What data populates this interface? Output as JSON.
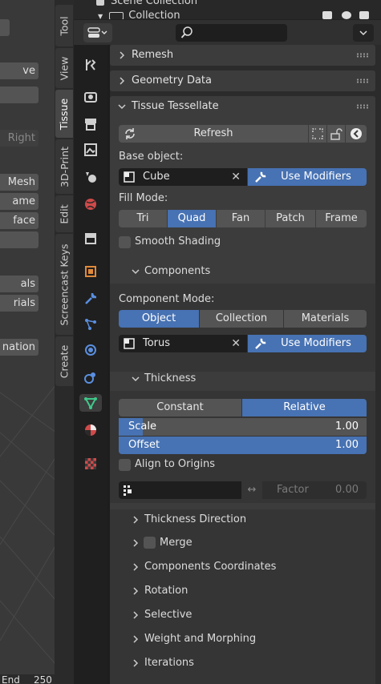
{
  "viewport": {
    "buttons": [
      {
        "label": "ve"
      },
      {
        "label": ""
      },
      {
        "label": "Right"
      },
      {
        "label": "Mesh"
      },
      {
        "label": "ame"
      },
      {
        "label": "face"
      },
      {
        "label": ""
      },
      {
        "label": "als"
      },
      {
        "label": "rials"
      },
      {
        "label": "nation"
      }
    ],
    "end_label": "End",
    "end_value": "250"
  },
  "vertical_tabs": [
    "Tool",
    "View",
    "Tissue",
    "3D-Print",
    "Edit",
    "Screencast Keys",
    "Create"
  ],
  "outliner": {
    "scene_collection": "Scene Collection",
    "collection": "Collection"
  },
  "properties_tabs": [
    {
      "icon": "tool-icon"
    },
    {
      "icon": "render-icon"
    },
    {
      "icon": "output-icon"
    },
    {
      "icon": "view-layer-icon"
    },
    {
      "icon": "scene-icon"
    },
    {
      "icon": "world-icon"
    },
    {
      "icon": "collection-icon"
    },
    {
      "icon": "object-icon"
    },
    {
      "icon": "modifier-icon"
    },
    {
      "icon": "particles-icon"
    },
    {
      "icon": "physics-icon"
    },
    {
      "icon": "constraints-icon"
    },
    {
      "icon": "data-icon"
    },
    {
      "icon": "material-icon"
    },
    {
      "icon": "texture-icon"
    }
  ],
  "panels": {
    "remesh": "Remesh",
    "geometry_data": "Geometry Data",
    "tissue_tessellate": "Tissue Tessellate"
  },
  "tissue": {
    "refresh_label": "Refresh",
    "base_object_label": "Base object:",
    "base_object_value": "Cube",
    "use_modifiers_label": "Use Modifiers",
    "fill_mode_label": "Fill Mode:",
    "fill_modes": [
      "Tri",
      "Quad",
      "Fan",
      "Patch",
      "Frame"
    ],
    "fill_mode_selected": "Quad",
    "smooth_shading_label": "Smooth Shading",
    "components_label": "Components",
    "component_mode_label": "Component Mode:",
    "component_modes": [
      "Object",
      "Collection",
      "Materials"
    ],
    "component_mode_selected": "Object",
    "component_object_value": "Torus",
    "component_use_modifiers_label": "Use Modifiers",
    "thickness_label": "Thickness",
    "thickness_modes": [
      "Constant",
      "Relative"
    ],
    "thickness_mode_selected": "Relative",
    "scale_label": "Scale",
    "scale_value": "1.00",
    "offset_label": "Offset",
    "offset_value": "1.00",
    "align_origins_label": "Align to Origins",
    "factor_label": "Factor",
    "factor_value": "0.00",
    "subpanels": [
      {
        "label": "Thickness Direction"
      },
      {
        "label": "Merge"
      },
      {
        "label": "Components Coordinates"
      },
      {
        "label": "Rotation"
      },
      {
        "label": "Selective"
      },
      {
        "label": "Weight and Morphing"
      },
      {
        "label": "Iterations"
      }
    ]
  },
  "colors": {
    "accent": "#4772b3",
    "panel": "#3c3c3c",
    "background": "#2b2b2b",
    "button": "#545454",
    "field": "#1e1e1e"
  }
}
